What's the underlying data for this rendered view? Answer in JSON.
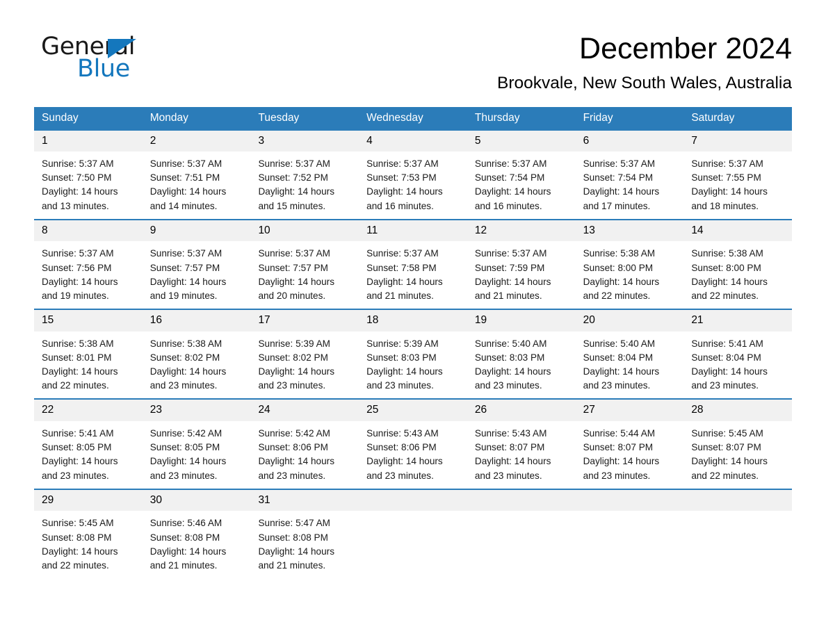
{
  "brand": {
    "name_dark": "General",
    "name_light": "Blue",
    "accent_color": "#1477bd"
  },
  "header": {
    "title": "December 2024",
    "subtitle": "Brookvale, New South Wales, Australia"
  },
  "calendar": {
    "header_color": "#2b7cb9",
    "weekdays": [
      "Sunday",
      "Monday",
      "Tuesday",
      "Wednesday",
      "Thursday",
      "Friday",
      "Saturday"
    ],
    "weeks": [
      [
        {
          "day": "1",
          "sunrise": "Sunrise: 5:37 AM",
          "sunset": "Sunset: 7:50 PM",
          "daylight": "Daylight: 14 hours and 13 minutes."
        },
        {
          "day": "2",
          "sunrise": "Sunrise: 5:37 AM",
          "sunset": "Sunset: 7:51 PM",
          "daylight": "Daylight: 14 hours and 14 minutes."
        },
        {
          "day": "3",
          "sunrise": "Sunrise: 5:37 AM",
          "sunset": "Sunset: 7:52 PM",
          "daylight": "Daylight: 14 hours and 15 minutes."
        },
        {
          "day": "4",
          "sunrise": "Sunrise: 5:37 AM",
          "sunset": "Sunset: 7:53 PM",
          "daylight": "Daylight: 14 hours and 16 minutes."
        },
        {
          "day": "5",
          "sunrise": "Sunrise: 5:37 AM",
          "sunset": "Sunset: 7:54 PM",
          "daylight": "Daylight: 14 hours and 16 minutes."
        },
        {
          "day": "6",
          "sunrise": "Sunrise: 5:37 AM",
          "sunset": "Sunset: 7:54 PM",
          "daylight": "Daylight: 14 hours and 17 minutes."
        },
        {
          "day": "7",
          "sunrise": "Sunrise: 5:37 AM",
          "sunset": "Sunset: 7:55 PM",
          "daylight": "Daylight: 14 hours and 18 minutes."
        }
      ],
      [
        {
          "day": "8",
          "sunrise": "Sunrise: 5:37 AM",
          "sunset": "Sunset: 7:56 PM",
          "daylight": "Daylight: 14 hours and 19 minutes."
        },
        {
          "day": "9",
          "sunrise": "Sunrise: 5:37 AM",
          "sunset": "Sunset: 7:57 PM",
          "daylight": "Daylight: 14 hours and 19 minutes."
        },
        {
          "day": "10",
          "sunrise": "Sunrise: 5:37 AM",
          "sunset": "Sunset: 7:57 PM",
          "daylight": "Daylight: 14 hours and 20 minutes."
        },
        {
          "day": "11",
          "sunrise": "Sunrise: 5:37 AM",
          "sunset": "Sunset: 7:58 PM",
          "daylight": "Daylight: 14 hours and 21 minutes."
        },
        {
          "day": "12",
          "sunrise": "Sunrise: 5:37 AM",
          "sunset": "Sunset: 7:59 PM",
          "daylight": "Daylight: 14 hours and 21 minutes."
        },
        {
          "day": "13",
          "sunrise": "Sunrise: 5:38 AM",
          "sunset": "Sunset: 8:00 PM",
          "daylight": "Daylight: 14 hours and 22 minutes."
        },
        {
          "day": "14",
          "sunrise": "Sunrise: 5:38 AM",
          "sunset": "Sunset: 8:00 PM",
          "daylight": "Daylight: 14 hours and 22 minutes."
        }
      ],
      [
        {
          "day": "15",
          "sunrise": "Sunrise: 5:38 AM",
          "sunset": "Sunset: 8:01 PM",
          "daylight": "Daylight: 14 hours and 22 minutes."
        },
        {
          "day": "16",
          "sunrise": "Sunrise: 5:38 AM",
          "sunset": "Sunset: 8:02 PM",
          "daylight": "Daylight: 14 hours and 23 minutes."
        },
        {
          "day": "17",
          "sunrise": "Sunrise: 5:39 AM",
          "sunset": "Sunset: 8:02 PM",
          "daylight": "Daylight: 14 hours and 23 minutes."
        },
        {
          "day": "18",
          "sunrise": "Sunrise: 5:39 AM",
          "sunset": "Sunset: 8:03 PM",
          "daylight": "Daylight: 14 hours and 23 minutes."
        },
        {
          "day": "19",
          "sunrise": "Sunrise: 5:40 AM",
          "sunset": "Sunset: 8:03 PM",
          "daylight": "Daylight: 14 hours and 23 minutes."
        },
        {
          "day": "20",
          "sunrise": "Sunrise: 5:40 AM",
          "sunset": "Sunset: 8:04 PM",
          "daylight": "Daylight: 14 hours and 23 minutes."
        },
        {
          "day": "21",
          "sunrise": "Sunrise: 5:41 AM",
          "sunset": "Sunset: 8:04 PM",
          "daylight": "Daylight: 14 hours and 23 minutes."
        }
      ],
      [
        {
          "day": "22",
          "sunrise": "Sunrise: 5:41 AM",
          "sunset": "Sunset: 8:05 PM",
          "daylight": "Daylight: 14 hours and 23 minutes."
        },
        {
          "day": "23",
          "sunrise": "Sunrise: 5:42 AM",
          "sunset": "Sunset: 8:05 PM",
          "daylight": "Daylight: 14 hours and 23 minutes."
        },
        {
          "day": "24",
          "sunrise": "Sunrise: 5:42 AM",
          "sunset": "Sunset: 8:06 PM",
          "daylight": "Daylight: 14 hours and 23 minutes."
        },
        {
          "day": "25",
          "sunrise": "Sunrise: 5:43 AM",
          "sunset": "Sunset: 8:06 PM",
          "daylight": "Daylight: 14 hours and 23 minutes."
        },
        {
          "day": "26",
          "sunrise": "Sunrise: 5:43 AM",
          "sunset": "Sunset: 8:07 PM",
          "daylight": "Daylight: 14 hours and 23 minutes."
        },
        {
          "day": "27",
          "sunrise": "Sunrise: 5:44 AM",
          "sunset": "Sunset: 8:07 PM",
          "daylight": "Daylight: 14 hours and 23 minutes."
        },
        {
          "day": "28",
          "sunrise": "Sunrise: 5:45 AM",
          "sunset": "Sunset: 8:07 PM",
          "daylight": "Daylight: 14 hours and 22 minutes."
        }
      ],
      [
        {
          "day": "29",
          "sunrise": "Sunrise: 5:45 AM",
          "sunset": "Sunset: 8:08 PM",
          "daylight": "Daylight: 14 hours and 22 minutes."
        },
        {
          "day": "30",
          "sunrise": "Sunrise: 5:46 AM",
          "sunset": "Sunset: 8:08 PM",
          "daylight": "Daylight: 14 hours and 21 minutes."
        },
        {
          "day": "31",
          "sunrise": "Sunrise: 5:47 AM",
          "sunset": "Sunset: 8:08 PM",
          "daylight": "Daylight: 14 hours and 21 minutes."
        },
        {
          "day": "",
          "sunrise": "",
          "sunset": "",
          "daylight": "",
          "empty": true
        },
        {
          "day": "",
          "sunrise": "",
          "sunset": "",
          "daylight": "",
          "empty": true
        },
        {
          "day": "",
          "sunrise": "",
          "sunset": "",
          "daylight": "",
          "empty": true
        },
        {
          "day": "",
          "sunrise": "",
          "sunset": "",
          "daylight": "",
          "empty": true
        }
      ]
    ]
  }
}
